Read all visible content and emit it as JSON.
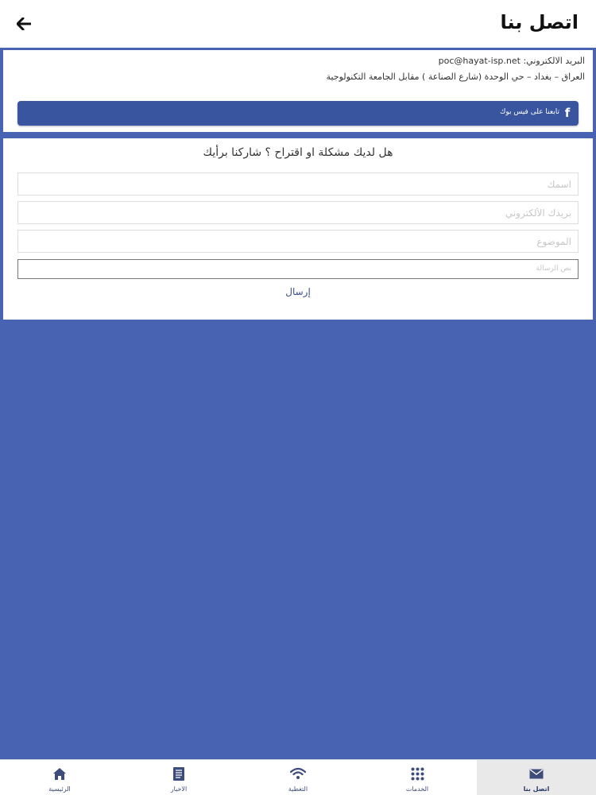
{
  "header": {
    "title": "اتصل بنا",
    "back_icon": "arrow-left-icon"
  },
  "contact": {
    "email_line": "البريد الالكتروني: poc@hayat-isp.net",
    "address_line": "العراق – بغداد – حي الوحدة (شارع الصناعة ) مقابل الجامعة التكنولوجية",
    "facebook_label": "تابعنا على فيس بوك",
    "facebook_icon": "facebook-icon"
  },
  "form": {
    "title": "هل لديك مشكلة او اقتراح ؟ شاركنا برأيك",
    "name_placeholder": "اسمك",
    "email_placeholder": "بريدك الألكتروني",
    "subject_placeholder": "الموضوع",
    "message_placeholder": "نص الرسالة",
    "send_label": "إرسال"
  },
  "tabs": [
    {
      "label": "الرئيسية",
      "icon": "home-icon",
      "active": false
    },
    {
      "label": "الاخبار",
      "icon": "news-icon",
      "active": false
    },
    {
      "label": "التغطية",
      "icon": "wifi-icon",
      "active": false
    },
    {
      "label": "الخدمات",
      "icon": "grid-icon",
      "active": false
    },
    {
      "label": "اتصل بنا",
      "icon": "mail-icon",
      "active": true
    }
  ],
  "colors": {
    "background": "#4763b2",
    "facebook_button": "#3a55a0",
    "tab_icon": "#3d4c7a"
  }
}
